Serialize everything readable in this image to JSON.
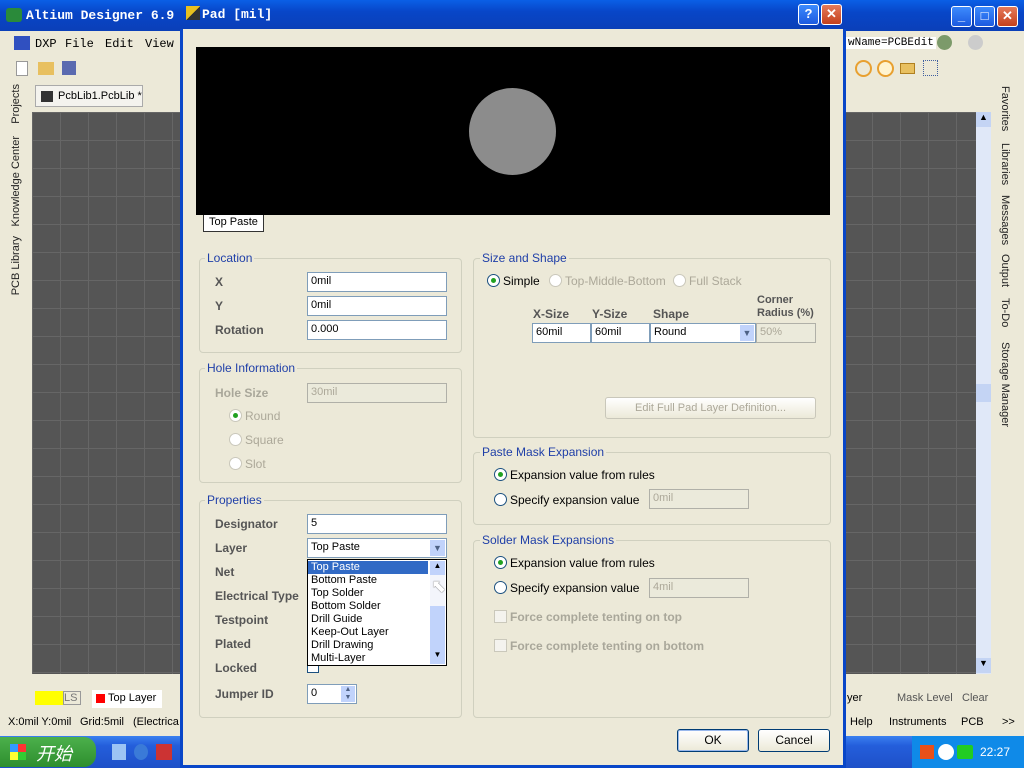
{
  "app": {
    "title": "Altium Designer 6.9",
    "menu": [
      "DXP",
      "File",
      "Edit",
      "View"
    ],
    "doc_tab": "PcbLib1.PcbLib *",
    "view_combo": "wName=PCBEdit",
    "left_panels": [
      "Projects",
      "Knowledge Center",
      "PCB Library"
    ],
    "right_panels": [
      "Favorites",
      "Libraries",
      "Messages",
      "Output",
      "To-Do",
      "Storage Manager"
    ],
    "layer_tabs": {
      "ls": "LS",
      "top_layer": "Top Layer",
      "partial": "yer",
      "mask_level": "Mask Level",
      "clear": "Clear"
    },
    "status": {
      "coords": "X:0mil Y:0mil",
      "grid": "Grid:5mil",
      "mode": "(Electrica"
    },
    "status_buttons": [
      "Help",
      "Instruments",
      "PCB",
      ">>"
    ]
  },
  "taskbar": {
    "start": "开始",
    "clock": "22:27"
  },
  "dialog": {
    "title": "Pad [mil]",
    "help": "?",
    "preview_tab": "Top Paste",
    "preview_colors": {
      "bg": "#000000",
      "pad": "#8c8c8c"
    },
    "location": {
      "legend": "Location",
      "x_label": "X",
      "x": "0mil",
      "y_label": "Y",
      "y": "0mil",
      "rot_label": "Rotation",
      "rotation": "0.000"
    },
    "hole": {
      "legend": "Hole Information",
      "size_label": "Hole Size",
      "size": "30mil",
      "options": [
        "Round",
        "Square",
        "Slot"
      ]
    },
    "properties": {
      "legend": "Properties",
      "designator_label": "Designator",
      "designator": "5",
      "layer_label": "Layer",
      "layer": "Top Paste",
      "net_label": "Net",
      "etype_label": "Electrical Type",
      "testpoint_label": "Testpoint",
      "plated_label": "Plated",
      "locked_label": "Locked",
      "jumper_label": "Jumper ID",
      "jumper": "0",
      "layer_options": [
        "Top Paste",
        "Bottom Paste",
        "Top Solder",
        "Bottom Solder",
        "Drill Guide",
        "Keep-Out Layer",
        "Drill Drawing",
        "Multi-Layer"
      ]
    },
    "size_shape": {
      "legend": "Size and Shape",
      "modes": [
        "Simple",
        "Top-Middle-Bottom",
        "Full Stack"
      ],
      "col_x": "X-Size",
      "col_y": "Y-Size",
      "col_shape": "Shape",
      "col_corner": "Corner Radius (%)",
      "x_size": "60mil",
      "y_size": "60mil",
      "shape": "Round",
      "corner": "50%",
      "edit_button": "Edit Full Pad Layer Definition..."
    },
    "paste": {
      "legend": "Paste Mask Expansion",
      "opt_rules": "Expansion value from rules",
      "opt_specify": "Specify expansion value",
      "value": "0mil"
    },
    "solder": {
      "legend": "Solder Mask Expansions",
      "opt_rules": "Expansion value from rules",
      "opt_specify": "Specify expansion value",
      "value": "4mil",
      "tent_top": "Force complete tenting on top",
      "tent_bottom": "Force complete tenting on bottom"
    },
    "ok": "OK",
    "cancel": "Cancel"
  }
}
